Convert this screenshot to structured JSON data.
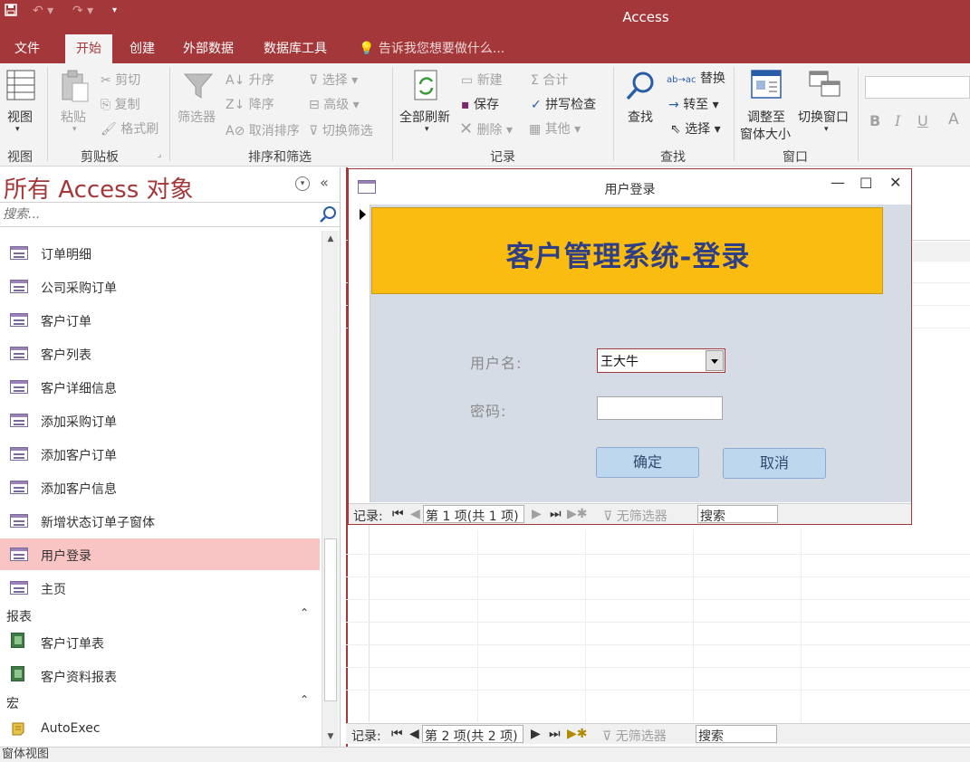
{
  "app": {
    "title": "Access"
  },
  "tabs": [
    {
      "label": "文件"
    },
    {
      "label": "开始"
    },
    {
      "label": "创建"
    },
    {
      "label": "外部数据"
    },
    {
      "label": "数据库工具"
    },
    {
      "label": "告诉我您想要做什么..."
    }
  ],
  "ribbon": {
    "view": {
      "view": "视图",
      "group": "视图"
    },
    "clipboard": {
      "paste": "粘贴",
      "cut": "剪切",
      "copy": "复制",
      "format_painter": "格式刷",
      "group": "剪贴板"
    },
    "sort": {
      "filter": "筛选器",
      "asc": "升序",
      "desc": "降序",
      "clear_sort": "取消排序",
      "select": "选择",
      "advanced": "高级",
      "toggle_filter": "切换筛选",
      "group": "排序和筛选"
    },
    "records": {
      "refresh": "全部刷新",
      "new": "新建",
      "save": "保存",
      "delete": "删除",
      "totals": "合计",
      "spelling": "拼写检查",
      "more": "其他",
      "group": "记录"
    },
    "find": {
      "find": "查找",
      "replace": "替换",
      "goto": "转至",
      "select": "选择",
      "group": "查找"
    },
    "window": {
      "size_to_fit_1": "调整至",
      "size_to_fit_2": "窗体大小",
      "switch": "切换窗口",
      "group": "窗口"
    },
    "text": {
      "bold": "B",
      "italic": "I",
      "underline": "U",
      "font_color": "A"
    }
  },
  "nav": {
    "title": "所有 Access 对象",
    "search_placeholder": "搜索...",
    "forms": [
      {
        "label": "订单明细"
      },
      {
        "label": "公司采购订单"
      },
      {
        "label": "客户订单"
      },
      {
        "label": "客户列表"
      },
      {
        "label": "客户详细信息"
      },
      {
        "label": "添加采购订单"
      },
      {
        "label": "添加客户订单"
      },
      {
        "label": "添加客户信息"
      },
      {
        "label": "新增状态订单子窗体"
      },
      {
        "label": "用户登录"
      },
      {
        "label": "主页"
      }
    ],
    "reports_section": "报表",
    "reports": [
      {
        "label": "客户订单表"
      },
      {
        "label": "客户资料报表"
      }
    ],
    "macros_section": "宏",
    "macros": [
      {
        "label": "AutoExec"
      }
    ]
  },
  "form": {
    "title": "用户登录",
    "header": "客户管理系统-登录",
    "username_label": "用户名:",
    "username_value": "王大牛",
    "password_label": "密码:",
    "ok": "确定",
    "cancel": "取消",
    "recnav": {
      "label": "记录:",
      "position": "第 1 项(共 1 项)",
      "filter": "无筛选器",
      "search": "搜索"
    }
  },
  "back_recnav": {
    "label": "记录:",
    "position": "第 2 项(共 2 项)",
    "filter": "无筛选器",
    "search": "搜索"
  },
  "status": {
    "text": "窗体视图"
  }
}
